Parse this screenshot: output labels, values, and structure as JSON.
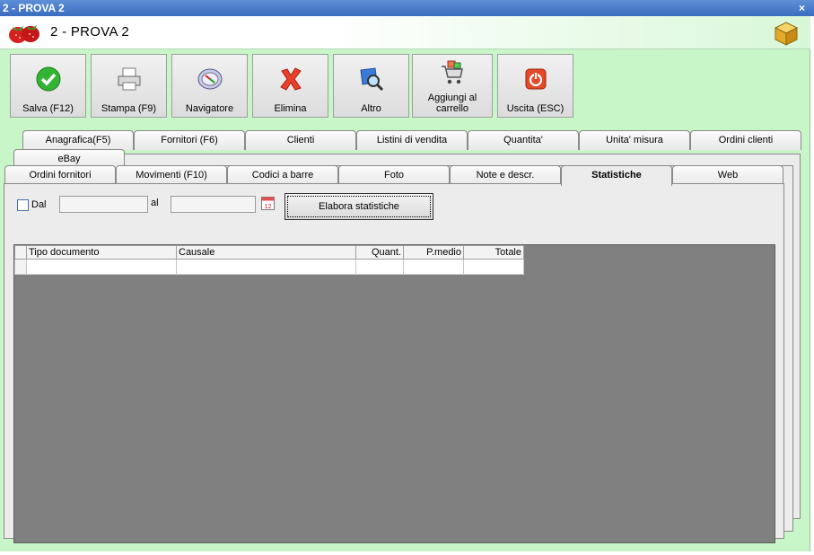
{
  "window": {
    "title": "2 - PROVA 2",
    "close_glyph": "×",
    "header_title": "2 - PROVA 2"
  },
  "toolbar": [
    {
      "label": "Salva (F12)",
      "icon": "check-icon"
    },
    {
      "label": "Stampa (F9)",
      "icon": "printer-icon"
    },
    {
      "label": "Navigatore",
      "icon": "compass-icon"
    },
    {
      "label": "Elimina",
      "icon": "x-icon"
    },
    {
      "label": "Altro",
      "icon": "magnifier-icon"
    },
    {
      "label": "Aggiungi al carrello",
      "icon": "cart-icon"
    },
    {
      "label": "Uscita (ESC)",
      "icon": "power-icon"
    }
  ],
  "tabs": {
    "row1": [
      "Anagrafica(F5)",
      "Fornitori (F6)",
      "Clienti",
      "Listini di vendita",
      "Quantita'",
      "Unita' misura",
      "Ordini clienti"
    ],
    "row2": [
      "eBay"
    ],
    "row3": [
      "Ordini fornitori",
      "Movimenti (F10)",
      "Codici a barre",
      "Foto",
      "Note e descr.",
      "Statistiche",
      "Web"
    ],
    "active": "Statistiche"
  },
  "filters": {
    "dal_label": "Dal",
    "al_label": "al",
    "dal_value": "",
    "al_value": "",
    "calendar_glyph": "12",
    "elabora_label": "Elabora statistiche"
  },
  "grid": {
    "columns": [
      "Tipo documento",
      "Causale",
      "Quant.",
      "P.medio",
      "Totale"
    ]
  },
  "colors": {
    "window_bg": "#c9f6c9",
    "titlebar": "#3a6cbf",
    "grid_bg": "#808080"
  }
}
